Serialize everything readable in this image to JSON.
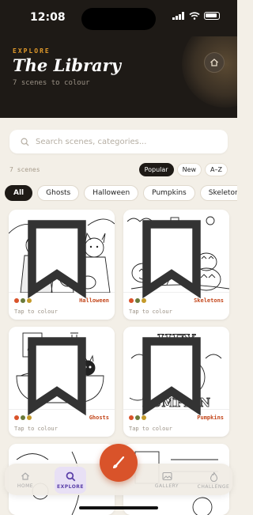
{
  "status": {
    "time": "12:08"
  },
  "header": {
    "eyebrow": "EXPLORE",
    "title": "The Library",
    "subtitle": "7 scenes to colour"
  },
  "search": {
    "placeholder": "Search scenes, categories..."
  },
  "list": {
    "count": "7 scenes",
    "sort_options": [
      "Popular",
      "New",
      "A–Z"
    ],
    "active_sort": "Popular"
  },
  "filters": {
    "chips": [
      "All",
      "Ghosts",
      "Halloween",
      "Pumpkins",
      "Skeleton"
    ],
    "active": "All"
  },
  "cards": [
    {
      "category": "Halloween",
      "action": "Tap to colour",
      "dots": [
        "#d9532a",
        "#6a7a3a",
        "#c49a2a"
      ]
    },
    {
      "category": "Skeletons",
      "action": "Tap to colour",
      "dots": [
        "#d9532a",
        "#6a7a3a",
        "#c49a2a"
      ]
    },
    {
      "category": "Ghosts",
      "action": "Tap to colour",
      "dots": [
        "#d9532a",
        "#6a7a3a",
        "#c49a2a"
      ]
    },
    {
      "category": "Pumpkins",
      "action": "Tap to colour",
      "dots": [
        "#d9532a",
        "#6a7a3a",
        "#c49a2a"
      ]
    }
  ],
  "artwork_text": {
    "card4_line1": "HEY",
    "card4_line2": "PUMPKIN"
  },
  "nav": {
    "home": "HOME",
    "explore": "EXPLORE",
    "gallery": "GALLERY",
    "challenge": "CHALLENGE"
  },
  "colors": {
    "accent": "#d9532a",
    "header_bg": "#1e1a16",
    "eyebrow": "#e39b2b",
    "nav_active": "#5a3fa8"
  }
}
